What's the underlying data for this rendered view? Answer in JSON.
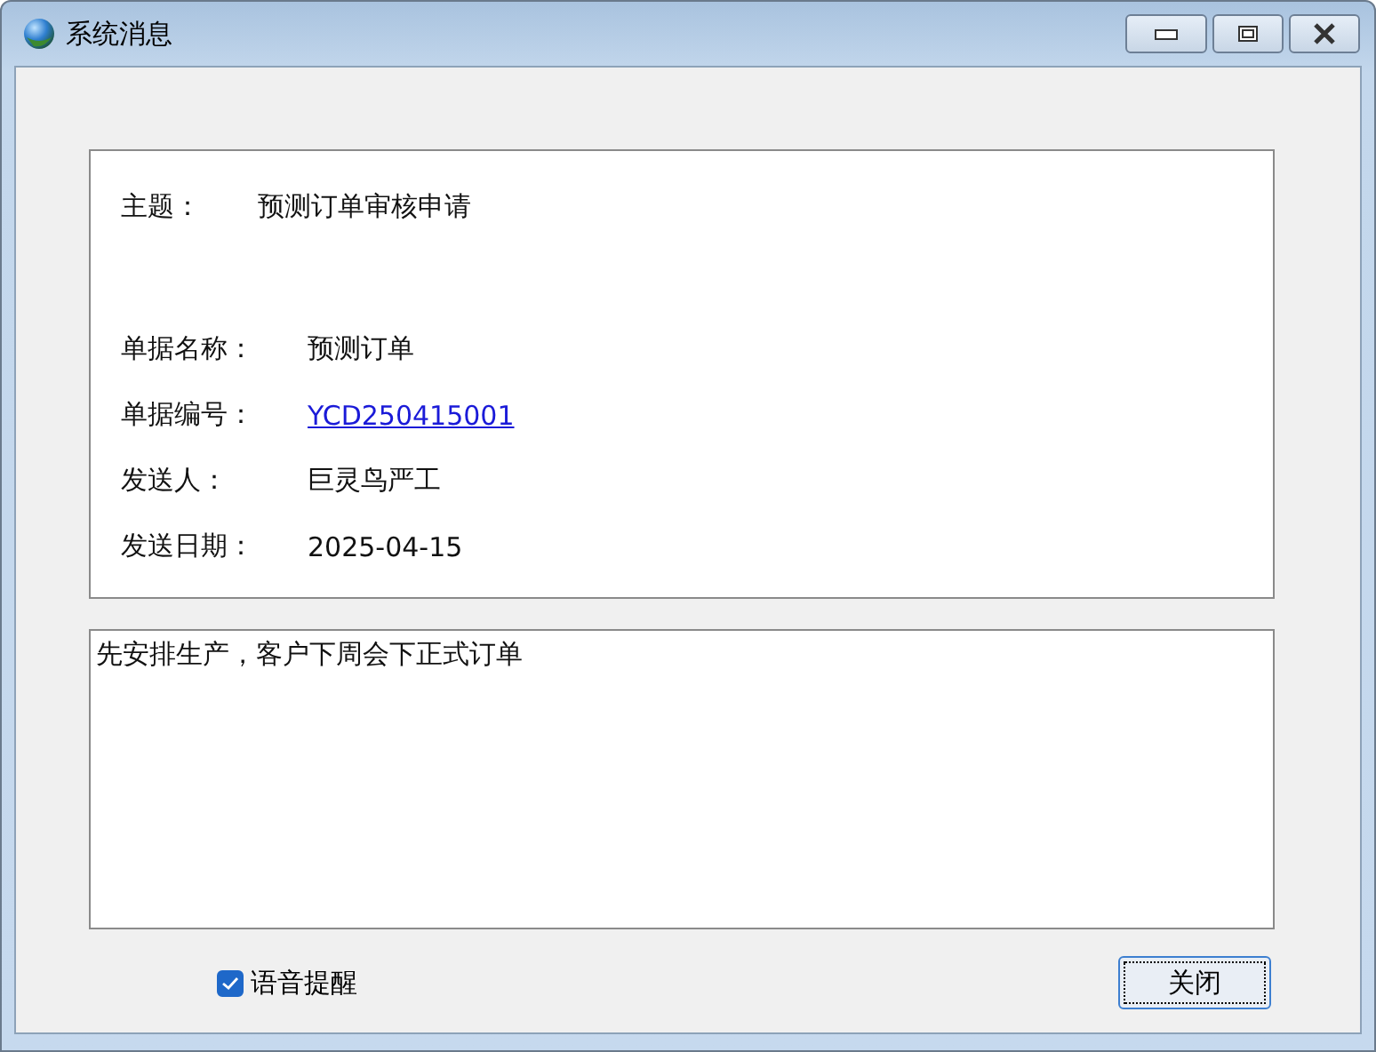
{
  "window": {
    "title": "系统消息"
  },
  "subject": {
    "label": "主题：",
    "value": "预测订单审核申请"
  },
  "fields": [
    {
      "label": "单据名称：",
      "value": "预测订单",
      "kind": "text"
    },
    {
      "label": "单据编号：",
      "value": "YCD250415001",
      "kind": "link"
    },
    {
      "label": "发送人：",
      "value": "巨灵鸟严工",
      "kind": "text"
    },
    {
      "label": "发送日期：",
      "value": "2025-04-15",
      "kind": "text"
    }
  ],
  "message": {
    "value": "先安排生产，客户下周会下正式订单"
  },
  "voice_reminder": {
    "label": "语音提醒",
    "checked": true
  },
  "buttons": [
    {
      "label": "关闭",
      "focused": true
    }
  ]
}
